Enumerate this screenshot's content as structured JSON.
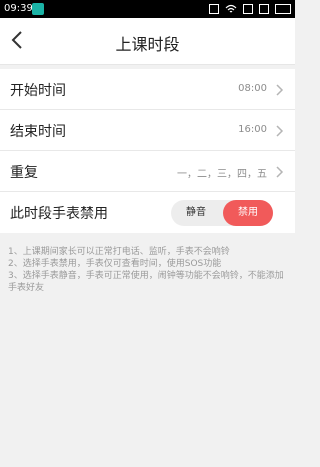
{
  "status": {
    "time": "09:39"
  },
  "nav": {
    "title": "上课时段"
  },
  "rows": [
    {
      "label": "开始时间",
      "value": "08:00"
    },
    {
      "label": "结束时间",
      "value": "16:00"
    },
    {
      "label": "重复",
      "value": "一，二，三，四，五"
    }
  ],
  "disable": {
    "label": "此时段手表禁用",
    "options": [
      {
        "label": "静音"
      },
      {
        "label": "禁用"
      }
    ],
    "selected": "禁用",
    "accent": "#f15a5a"
  },
  "notes": [
    "1、上课期间家长可以正常打电话、监听，手表不会响铃",
    "2、选择手表禁用，手表仅可查看时间，使用SOS功能",
    "3、选择手表静音，手表可正常使用，闹钟等功能不会响铃，不能添加手表好友"
  ]
}
